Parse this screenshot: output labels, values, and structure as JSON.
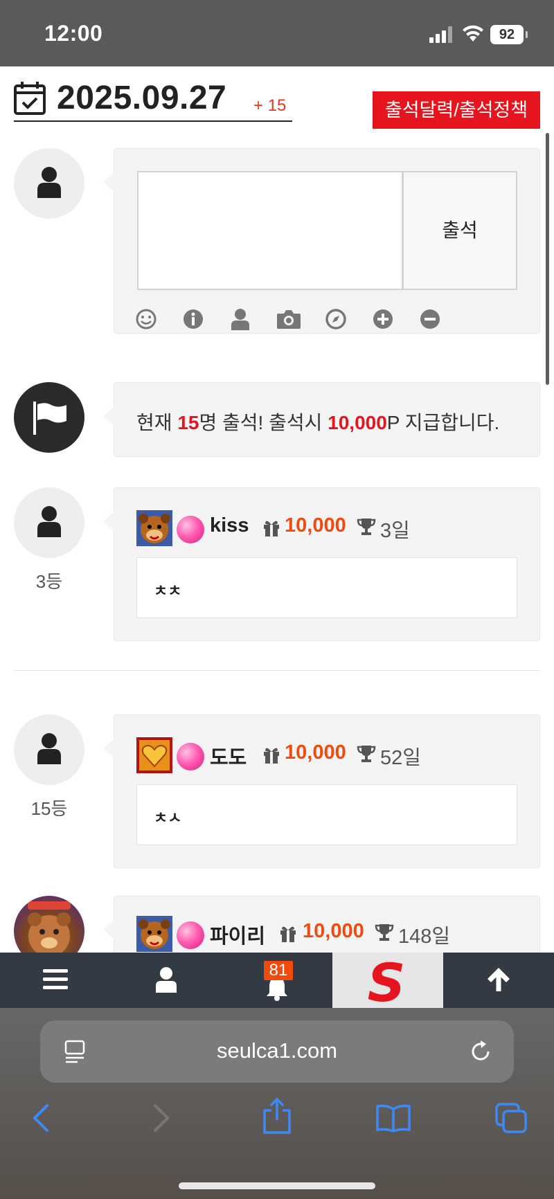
{
  "status_bar": {
    "time": "12:00",
    "battery": "92"
  },
  "header": {
    "date": "2025.09.27",
    "plus_count": "+ 15",
    "policy_button": "출석달력/출석정책"
  },
  "compose": {
    "attend_button": "출석"
  },
  "notice": {
    "prefix": "현재 ",
    "count": "15",
    "mid": "명 출석! 출석시 ",
    "points": "10,000",
    "suffix": "P 지급합니다."
  },
  "entries": [
    {
      "rank": "3등",
      "username": "kiss",
      "points": "10,000",
      "days": "3일",
      "comment": "ㅊㅊ"
    },
    {
      "rank": "15등",
      "username": "도도",
      "points": "10,000",
      "days": "52일",
      "comment": "ㅊㅅ"
    },
    {
      "username": "파이리",
      "points": "10,000",
      "days": "148일"
    }
  ],
  "site_nav": {
    "notification_count": "81",
    "logo_letter": "S"
  },
  "browser": {
    "url": "seulca1.com"
  },
  "colors": {
    "accent_red": "#e5141f",
    "points_orange": "#f04a0f",
    "nav_bg": "#323a44",
    "bubble_bg": "#f4f4f4"
  }
}
